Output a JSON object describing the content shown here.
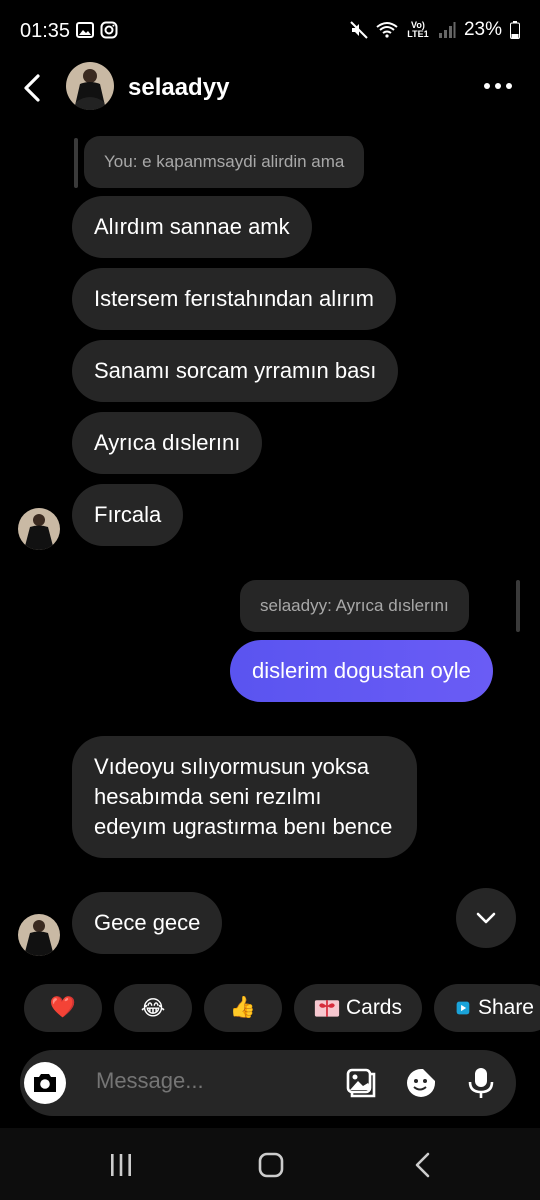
{
  "status_bar": {
    "time": "01:35",
    "battery": "23%",
    "left_icons": [
      "gallery-icon",
      "instagram-icon"
    ],
    "right_icons": [
      "mute-icon",
      "wifi-icon",
      "volte-icon",
      "signal-icon",
      "battery-icon"
    ],
    "volte_label": "Vo) LTE1"
  },
  "header": {
    "username": "selaadyy"
  },
  "messages": {
    "reply1": "You: e kapanmsaydi alirdin ama",
    "m1": "Alırdım sannae amk",
    "m2": "Istersem ferıstahından alırım",
    "m3": "Sanamı sorcam yrramın bası",
    "m4": "Ayrıca dıslerını",
    "m5": "Fırcala",
    "reply2": "selaadyy: Ayrıca dıslerını",
    "sent1": "dislerim dogustan oyle",
    "m6": "Vıdeoyu sılıyormusun yoksa hesabımda seni rezılmı edeyım ugrastırma benı bence",
    "m7": "Gece gece"
  },
  "quick_replies": {
    "heart": "❤️",
    "laugh": "😂",
    "thumbs": "👍",
    "cards_label": "Cards",
    "share_label": "Share"
  },
  "composer": {
    "placeholder": "Message..."
  },
  "colors": {
    "background": "#000000",
    "bubble_received": "#262626",
    "bubble_sent": "#5b55f1",
    "muted_text": "#a8a8a8"
  }
}
